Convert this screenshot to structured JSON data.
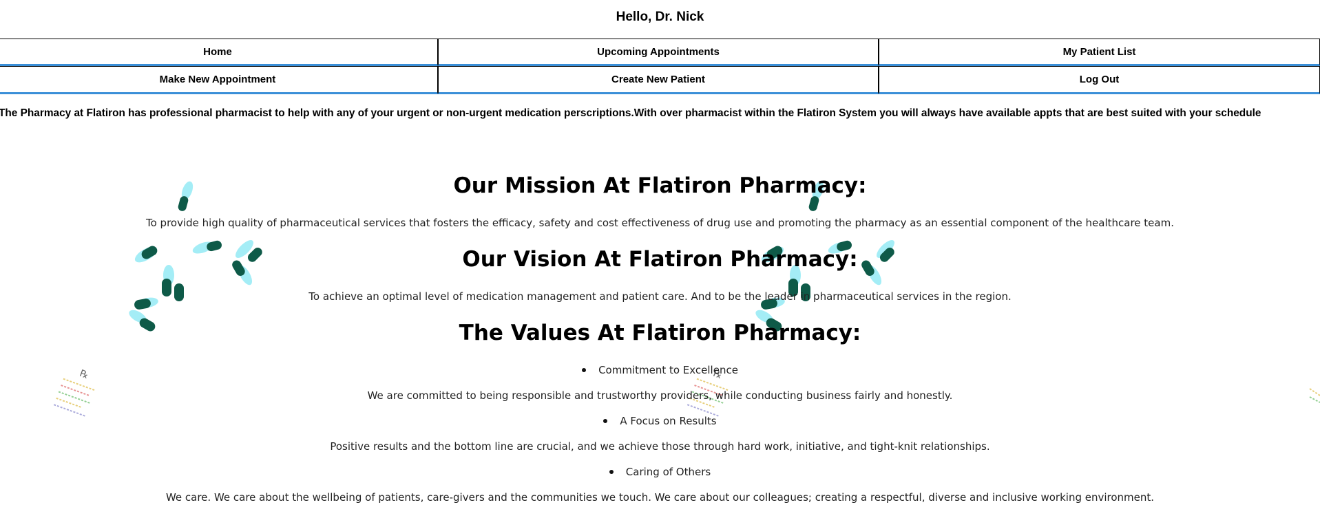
{
  "header": {
    "greeting": "Hello, Dr. Nick"
  },
  "nav": {
    "home": "Home",
    "upcoming": "Upcoming Appointments",
    "patient_list": "My Patient List",
    "make_appointment": "Make New Appointment",
    "create_patient": "Create New Patient",
    "logout": "Log Out"
  },
  "intro": "The Pharmacy at Flatiron has professional pharmacist to help with any of your urgent or non-urgent medication perscriptions.With over pharmacist within the Flatiron System you will always have available appts that are best suited with your schedule",
  "mission": {
    "title": "Our Mission At Flatiron Pharmacy:",
    "text": "To provide high quality of pharmaceutical services that fosters the efficacy, safety and cost effectiveness of drug use and promoting the pharmacy as an essential component of the healthcare team."
  },
  "vision": {
    "title": "Our Vision At Flatiron Pharmacy:",
    "text": "To achieve an optimal level of medication management and patient care. And to be the leader in pharmaceutical services in the region."
  },
  "values": {
    "title": "The Values At Flatiron Pharmacy:",
    "items": [
      {
        "heading": "Commitment to Excellence",
        "text": "We are committed to being responsible and trustworthy providers, while conducting business fairly and honestly."
      },
      {
        "heading": "A Focus on Results",
        "text": "Positive results and the bottom line are crucial, and we achieve those through hard work, initiative, and tight-knit relationships."
      },
      {
        "heading": "Caring of Others",
        "text": "We care. We care about the wellbeing of patients, care-givers and the communities we touch. We care about our colleagues; creating a respectful, diverse and inclusive working environment."
      }
    ]
  },
  "decor": {
    "background_images": [
      "capsule-pills-image",
      "prescription-note-image"
    ],
    "colors": {
      "nav_underline": "#3a8fd8",
      "pill_green": "#0e5a48",
      "pill_glow": "#7de6f2"
    }
  }
}
